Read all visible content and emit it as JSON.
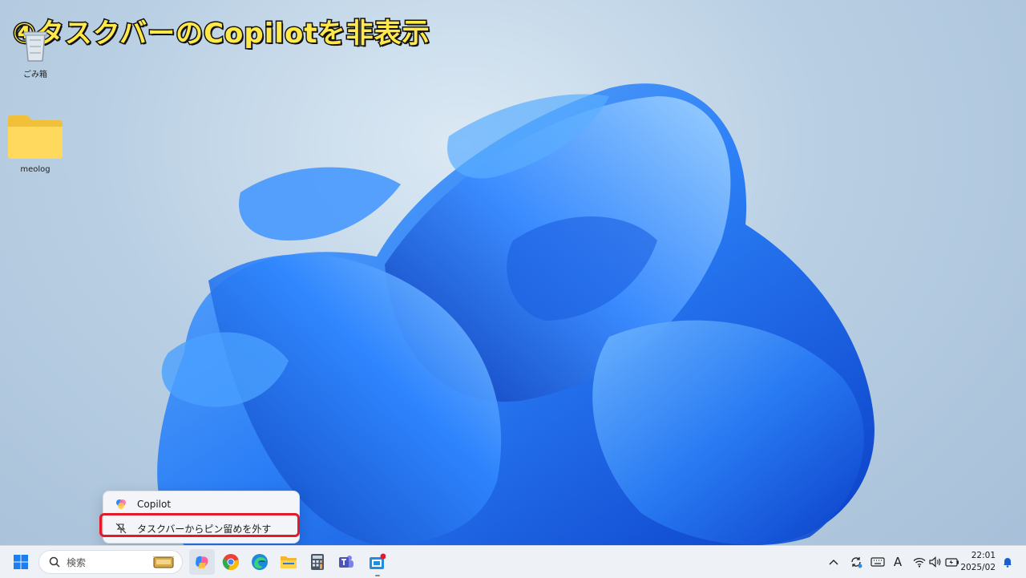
{
  "banner": {
    "title": "④タスクバーのCopilotを非表示"
  },
  "desktop": {
    "icons": [
      {
        "name": "recycle-bin",
        "label": "ごみ箱"
      },
      {
        "name": "folder",
        "label": "meolog"
      }
    ]
  },
  "context_menu": {
    "items": [
      {
        "label": "Copilot",
        "icon": "copilot-icon"
      },
      {
        "label": "タスクバーからピン留めを外す",
        "icon": "unpin-icon"
      }
    ]
  },
  "taskbar": {
    "search_placeholder": "検索",
    "apps": [
      "start-icon",
      "copilot-icon",
      "chrome-icon",
      "edge-icon",
      "file-explorer-icon",
      "calculator-icon",
      "teams-icon",
      "store-icon"
    ]
  },
  "tray": {
    "ime_label": "A",
    "time": "22:01",
    "date": "2025/02"
  },
  "colors": {
    "highlight": "#e11b2a",
    "banner_text": "#ffe84a",
    "wallpaper_blue": "#1f6cf0"
  }
}
